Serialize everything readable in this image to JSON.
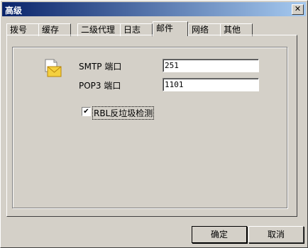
{
  "window": {
    "title": "高级",
    "close_glyph": "✕"
  },
  "tabs": [
    {
      "label": "拨号"
    },
    {
      "label": "缓存"
    },
    {
      "label": "二级代理"
    },
    {
      "label": "日志"
    },
    {
      "label": "邮件",
      "active": true
    },
    {
      "label": "网络"
    },
    {
      "label": "其他"
    }
  ],
  "mail": {
    "icon": "mail-envelope-icon",
    "smtp_label": "SMTP 端口",
    "smtp_value": "251",
    "pop3_label": "POP3 端口",
    "pop3_value": "1101",
    "rbl_checked": true,
    "rbl_label": "RBL反垃圾检测"
  },
  "buttons": {
    "ok": "确定",
    "cancel": "取消"
  }
}
